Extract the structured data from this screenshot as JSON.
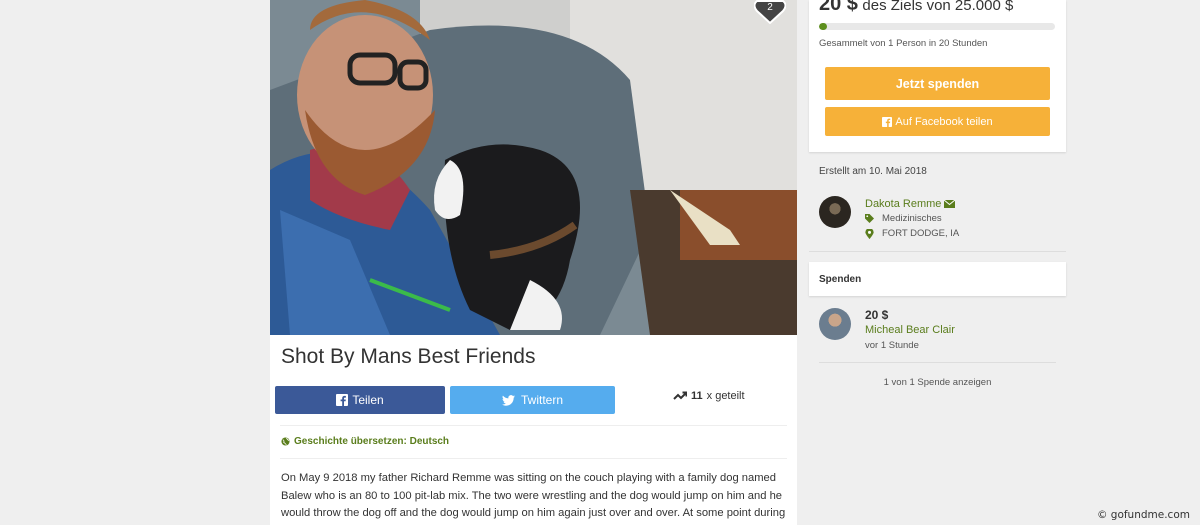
{
  "campaign": {
    "title": "Shot By Mans Best Friends",
    "photo_alt": "",
    "heart_count": "2"
  },
  "share": {
    "facebook_label": "Teilen",
    "twitter_label": "Twittern",
    "shared_count": "11",
    "shared_suffix": "x geteilt",
    "icons": [
      "facebook-icon",
      "twitter-icon",
      "trending-up-icon"
    ]
  },
  "translate": {
    "label": "Geschichte übersetzen: Deutsch",
    "icon": "globe-icon"
  },
  "story": {
    "text": "On May 9 2018 my father Richard Remme was sitting on the couch playing with a family dog named Balew who is an 80 to 100 pit-lab mix. The two were wrestling and the dog would jump on him and he would throw the dog off and the dog would jump on him again just over and over. At some point during"
  },
  "goal": {
    "raised": "20 $",
    "goal_text": "des Ziels von 25.000 $",
    "progress_fraction": 0.0008,
    "collected_text": "Gesammelt von 1 Person in 20 Stunden"
  },
  "buttons": {
    "donate_label": "Jetzt spenden",
    "facebook_share_label": "Auf Facebook teilen"
  },
  "organizer": {
    "created_text": "Erstellt am 10. Mai 2018",
    "name": "Dakota Remme",
    "category": "Medizinisches",
    "location": "FORT DODGE, IA"
  },
  "donations": {
    "heading": "Spenden",
    "items": [
      {
        "amount": "20 $",
        "name": "Micheal Bear Clair",
        "time": "vor 1 Stunde"
      }
    ],
    "show_more": "1 von 1 Spende anzeigen"
  },
  "watermark": "© gofundme.com",
  "colors": {
    "accent_green": "#5a7d1c",
    "donate_orange": "#f6b139",
    "facebook_blue": "#3b5998",
    "twitter_blue": "#55acee"
  }
}
